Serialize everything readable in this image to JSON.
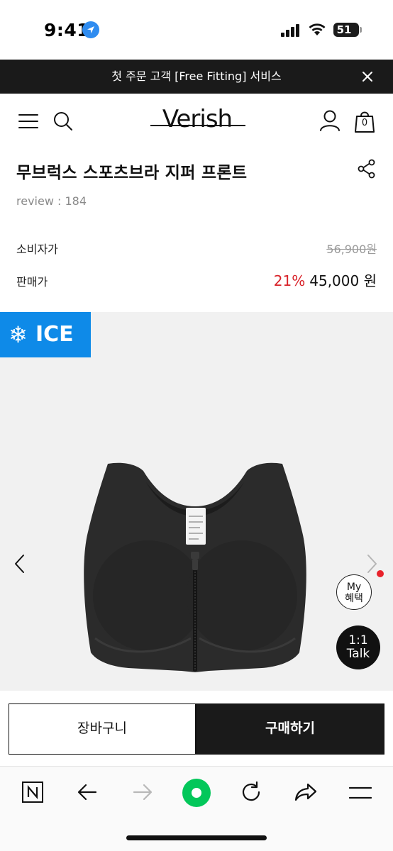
{
  "status_bar": {
    "time": "9:41",
    "battery": "51",
    "icons": [
      "location-arrow-icon",
      "cellular-signal-icon",
      "wifi-icon",
      "battery-icon"
    ]
  },
  "promo_banner": {
    "text": "첫 주문 고객 [Free Fitting] 서비스",
    "background": "#1a1a1a"
  },
  "header": {
    "logo": "Verish",
    "cart_count": "0",
    "icons": [
      "hamburger-menu-icon",
      "search-icon",
      "user-icon",
      "shopping-bag-icon"
    ]
  },
  "product": {
    "title": "무브럭스 스포츠브라 지퍼 프론트",
    "review": "review : 184",
    "consumer_price_label": "소비자가",
    "consumer_price": "56,900원",
    "sale_price_label": "판매가",
    "discount_rate": "21%",
    "sale_price": "45,000 원"
  },
  "gallery": {
    "badge_text": "ICE",
    "badge_color": "#0e8ae8",
    "badge_icon": "snowflake-icon"
  },
  "floating": {
    "benefit_line1": "My",
    "benefit_line2": "혜택",
    "talk_line1": "1:1",
    "talk_line2": "Talk"
  },
  "actions": {
    "cart_label": "장바구니",
    "buy_label": "구매하기"
  },
  "browser_toolbar": {
    "icons": [
      "naver-home-icon",
      "back-arrow-icon",
      "forward-arrow-icon",
      "green-dot-icon",
      "reload-icon",
      "share-arrow-icon",
      "menu-lines-icon"
    ],
    "accent": "#03c75a"
  }
}
